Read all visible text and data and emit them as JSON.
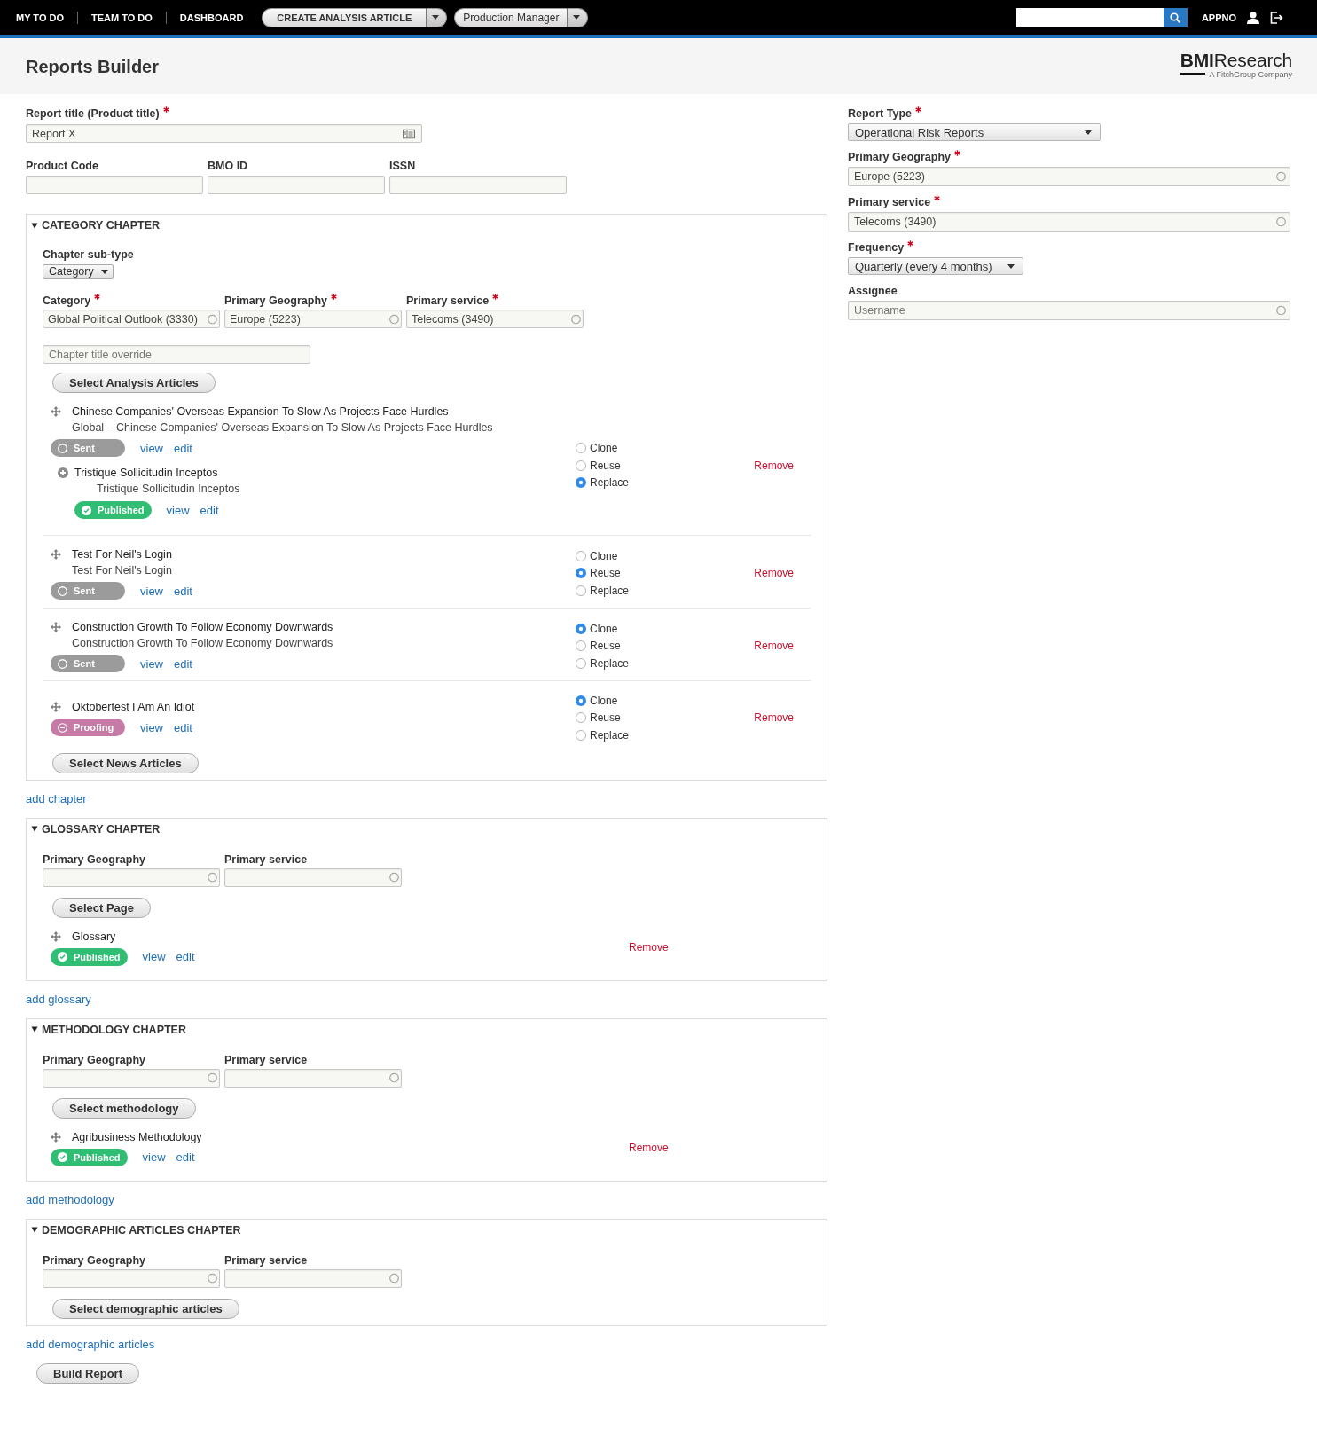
{
  "top_nav": {
    "links": [
      "MY TO DO",
      "TEAM TO DO",
      "DASHBOARD"
    ],
    "split_buttons": [
      {
        "label": "CREATE ANALYSIS ARTICLE",
        "kind": "caps"
      },
      {
        "label": "Production Manager",
        "kind": "plain"
      }
    ],
    "user": "APPNO"
  },
  "header": {
    "title": "Reports Builder",
    "logo": {
      "wordmark": "**BMI**Research",
      "tagline": "A FitchGroup Company"
    }
  },
  "report_title": {
    "label": "Report title (Product title)",
    "required": true,
    "value": "Report X"
  },
  "codes": [
    {
      "label": "Product Code"
    },
    {
      "label": "BMO ID"
    },
    {
      "label": "ISSN"
    }
  ],
  "chapters": [
    {
      "title": "CATEGORY CHAPTER",
      "expanded": true,
      "sub_type": {
        "label": "Chapter sub-type",
        "value": "Category"
      },
      "fields": [
        {
          "label": "Category",
          "required": true,
          "value": "Global Political Outlook (3330)"
        },
        {
          "label": "Primary Geography",
          "required": true,
          "value": "Europe (5223)"
        },
        {
          "label": "Primary service",
          "required": true,
          "value": "Telecoms (3490)"
        }
      ],
      "title_override": {
        "placeholder": "Chapter title override"
      },
      "select_button": "Select Analysis Articles",
      "items": [
        {
          "title": "Chinese Companies' Overseas Expansion To Slow As Projects Face Hurdles",
          "subtitle": "Global – Chinese Companies' Overseas Expansion To Slow As Projects Face Hurdles",
          "status": {
            "kind": "sent",
            "label": "Sent"
          },
          "links": [
            "view",
            "edit"
          ],
          "options": [
            {
              "label": "Clone",
              "selected": false
            },
            {
              "label": "Reuse",
              "selected": false
            },
            {
              "label": "Replace",
              "selected": true
            }
          ],
          "remove": "Remove",
          "children": [
            {
              "title": "Tristique Sollicitudin Inceptos",
              "subtitle": "Tristique Sollicitudin Inceptos",
              "status": {
                "kind": "published",
                "label": "Published"
              },
              "links": [
                "view",
                "edit"
              ]
            }
          ]
        },
        {
          "title": "Test For Neil's Login",
          "subtitle": "Test For Neil's Login",
          "status": {
            "kind": "sent",
            "label": "Sent"
          },
          "links": [
            "view",
            "edit"
          ],
          "options": [
            {
              "label": "Clone",
              "selected": false
            },
            {
              "label": "Reuse",
              "selected": true
            },
            {
              "label": "Replace",
              "selected": false
            }
          ],
          "remove": "Remove"
        },
        {
          "title": "Construction Growth To Follow Economy Downwards",
          "subtitle": "Construction Growth To Follow Economy Downwards",
          "status": {
            "kind": "sent",
            "label": "Sent"
          },
          "links": [
            "view",
            "edit"
          ],
          "options": [
            {
              "label": "Clone",
              "selected": true
            },
            {
              "label": "Reuse",
              "selected": false
            },
            {
              "label": "Replace",
              "selected": false
            }
          ],
          "remove": "Remove"
        },
        {
          "title": "Oktobertest I Am An Idiot",
          "status": {
            "kind": "proofing",
            "label": "Proofing"
          },
          "links": [
            "view",
            "edit"
          ],
          "options": [
            {
              "label": "Clone",
              "selected": true
            },
            {
              "label": "Reuse",
              "selected": false
            },
            {
              "label": "Replace",
              "selected": false
            }
          ],
          "remove": "Remove"
        }
      ],
      "footer_button": "Select News Articles",
      "add_link": "add chapter"
    },
    {
      "title": "GLOSSARY CHAPTER",
      "expanded": true,
      "fields": [
        {
          "label": "Primary Geography",
          "required": false
        },
        {
          "label": "Primary service",
          "required": false
        }
      ],
      "select_button": "Select Page",
      "items": [
        {
          "title": "Glossary",
          "status": {
            "kind": "published",
            "label": "Published"
          },
          "links": [
            "view",
            "edit"
          ],
          "remove": "Remove"
        }
      ],
      "add_link": "add glossary"
    },
    {
      "title": "METHODOLOGY CHAPTER",
      "expanded": true,
      "fields": [
        {
          "label": "Primary Geography",
          "required": false
        },
        {
          "label": "Primary service",
          "required": false
        }
      ],
      "select_button": "Select methodology",
      "items": [
        {
          "title": "Agribusiness Methodology",
          "status": {
            "kind": "published",
            "label": "Published"
          },
          "links": [
            "view",
            "edit"
          ],
          "remove": "Remove"
        }
      ],
      "add_link": "add methodology"
    },
    {
      "title": "DEMOGRAPHIC ARTICLES CHAPTER",
      "expanded": true,
      "fields": [
        {
          "label": "Primary Geography",
          "required": false
        },
        {
          "label": "Primary service",
          "required": false
        }
      ],
      "select_button": "Select demographic articles",
      "add_link": "add demographic articles"
    }
  ],
  "build_button": "Build Report",
  "settings": [
    {
      "kind": "select",
      "label": "Report Type",
      "required": true,
      "value": "Operational Risk Reports"
    },
    {
      "kind": "autocomplete",
      "label": "Primary Geography",
      "required": true,
      "value": "Europe (5223)"
    },
    {
      "kind": "autocomplete",
      "label": "Primary service",
      "required": true,
      "value": "Telecoms (3490)"
    },
    {
      "kind": "select",
      "label": "Frequency",
      "required": true,
      "value": "Quarterly (every 4 months)"
    },
    {
      "kind": "autocomplete",
      "label": "Assignee",
      "required": false,
      "placeholder": "Username"
    }
  ]
}
